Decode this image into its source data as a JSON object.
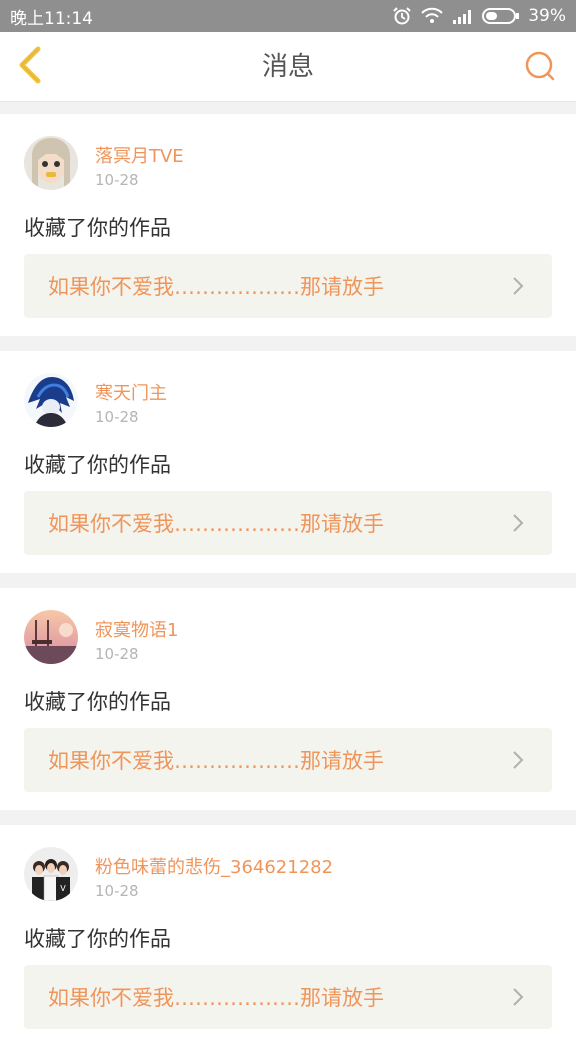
{
  "status": {
    "time": "晚上11:14",
    "battery": "39%"
  },
  "header": {
    "title": "消息"
  },
  "colors": {
    "accent": "#f0955a",
    "back_icon": "#f2c23a"
  },
  "messages": [
    {
      "username": "落冥月TVE",
      "date": "10-28",
      "action": "收藏了你的作品",
      "work_title": "如果你不爱我………………那请放手"
    },
    {
      "username": "寒天门主",
      "date": "10-28",
      "action": "收藏了你的作品",
      "work_title": "如果你不爱我………………那请放手"
    },
    {
      "username": "寂寞物语1",
      "date": "10-28",
      "action": "收藏了你的作品",
      "work_title": "如果你不爱我………………那请放手"
    },
    {
      "username": "粉色味蕾的悲伤_364621282",
      "date": "10-28",
      "action": "收藏了你的作品",
      "work_title": "如果你不爱我………………那请放手"
    }
  ]
}
